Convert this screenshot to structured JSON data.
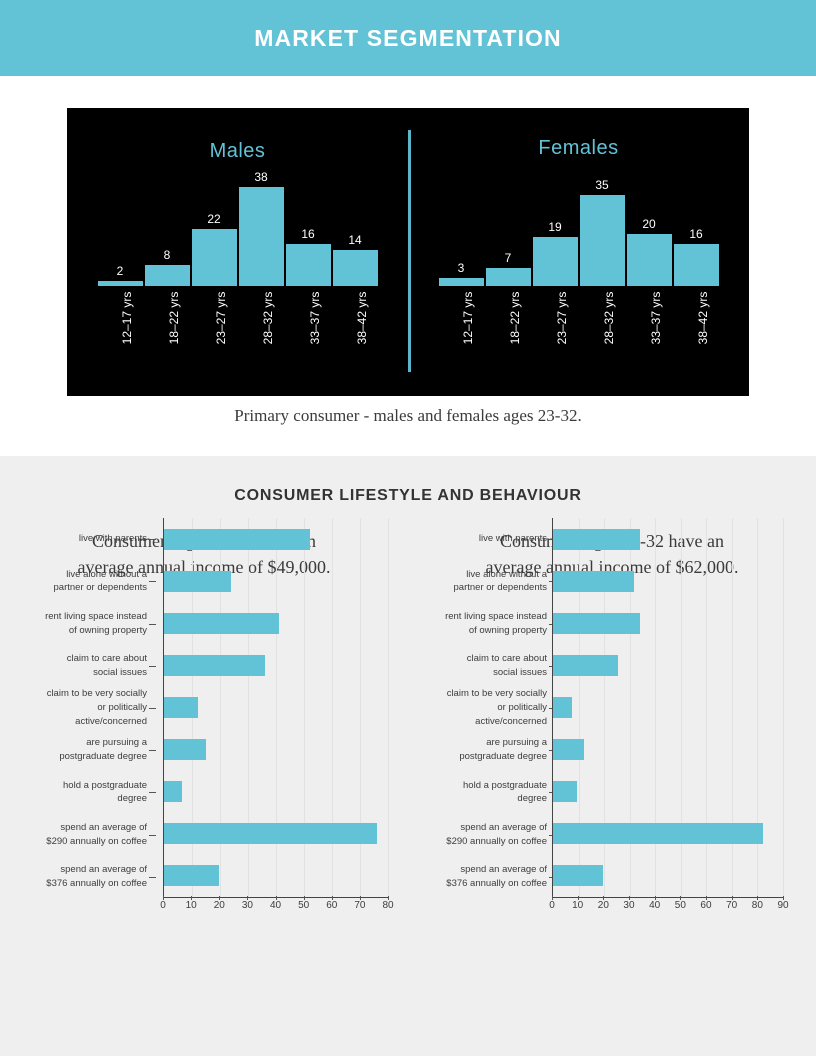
{
  "header": {
    "title": "MARKET SEGMENTATION",
    "accent_color": "#62c2d6"
  },
  "section1": {
    "panel_bg": "#000000",
    "caption": "Primary consumer - males and females ages 23-32.",
    "males_title": "Males",
    "females_title": "Females"
  },
  "section2": {
    "title": "CONSUMER LIFESTYLE AND BEHAVIOUR",
    "left_subtitle_line1": "Consumers ages 23-27 have an",
    "left_subtitle_line2": "average annual income of $49,000.",
    "right_subtitle_line1": "Consumers ages 28-32 have an",
    "right_subtitle_line2": "average annual income of $62,000."
  },
  "chart_data": [
    {
      "type": "bar",
      "title": "Males",
      "orientation": "vertical",
      "categories": [
        "12–17 yrs",
        "18–22 yrs",
        "23–27 yrs",
        "28–32 yrs",
        "33–37 yrs",
        "38–42 yrs"
      ],
      "values": [
        2,
        8,
        22,
        38,
        16,
        14
      ],
      "xlabel": "",
      "ylabel": "",
      "ylim": [
        0,
        40
      ],
      "grid": false,
      "legend": false,
      "bar_color": "#62c2d6",
      "label_color": "#ffffff",
      "background": "#000000"
    },
    {
      "type": "bar",
      "title": "Females",
      "orientation": "vertical",
      "categories": [
        "12–17 yrs",
        "18–22 yrs",
        "23–27 yrs",
        "28–32 yrs",
        "33–37 yrs",
        "38–42 yrs"
      ],
      "values": [
        3,
        7,
        19,
        35,
        20,
        16
      ],
      "xlabel": "",
      "ylabel": "",
      "ylim": [
        0,
        40
      ],
      "grid": false,
      "legend": false,
      "bar_color": "#62c2d6",
      "label_color": "#ffffff",
      "background": "#000000"
    },
    {
      "type": "bar",
      "title": "Consumers ages 23-27 have an average annual income of $49,000.",
      "orientation": "horizontal",
      "categories": [
        "live with parents",
        "live alone without a partner or dependents",
        "rent living space instead of owning property",
        "claim to care about social issues",
        "claim to be very socially or politically active/concerned",
        "are pursuing a postgraduate degree",
        "hold a postgraduate degree",
        "spend an average of $290 annually on coffee",
        "spend an average of $376 annually on coffee"
      ],
      "values": [
        52,
        24,
        41,
        36,
        12,
        15,
        6.5,
        76,
        19.5
      ],
      "xlabel": "",
      "ylabel": "",
      "xlim": [
        0,
        80
      ],
      "xticks": [
        0,
        10,
        20,
        30,
        40,
        50,
        60,
        70,
        80
      ],
      "grid": true,
      "legend": false,
      "bar_color": "#62c2d6",
      "background": "#efefef"
    },
    {
      "type": "bar",
      "title": "Consumers ages 28-32 have an average annual income of $62,000.",
      "orientation": "horizontal",
      "categories": [
        "live with parents",
        "live alone without a partner or dependents",
        "rent living space instead of owning property",
        "claim to care about social issues",
        "claim to be very socially or politically active/concerned",
        "are pursuing a postgraduate degree",
        "hold a postgraduate degree",
        "spend an average of $290 annually on coffee",
        "spend an average of $376 annually on coffee"
      ],
      "values": [
        34,
        31.5,
        34,
        25.5,
        7.5,
        12,
        9.5,
        82,
        19.5
      ],
      "xlabel": "",
      "ylabel": "",
      "xlim": [
        0,
        90
      ],
      "xticks": [
        0,
        10,
        20,
        30,
        40,
        50,
        60,
        70,
        80,
        90
      ],
      "grid": true,
      "legend": false,
      "bar_color": "#62c2d6",
      "background": "#efefef"
    }
  ],
  "category_labels_multiline": [
    [
      "live with parents"
    ],
    [
      "live alone without a",
      "partner or dependents"
    ],
    [
      "rent living space instead",
      "of owning property"
    ],
    [
      "claim to care about",
      "social issues"
    ],
    [
      "claim to be very socially",
      "or politically",
      "active/concerned"
    ],
    [
      "are pursuing a",
      "postgraduate degree"
    ],
    [
      "hold a postgraduate",
      "degree"
    ],
    [
      "spend an average of",
      "$290 annually on coffee"
    ],
    [
      "spend an average of",
      "$376 annually on coffee"
    ]
  ]
}
